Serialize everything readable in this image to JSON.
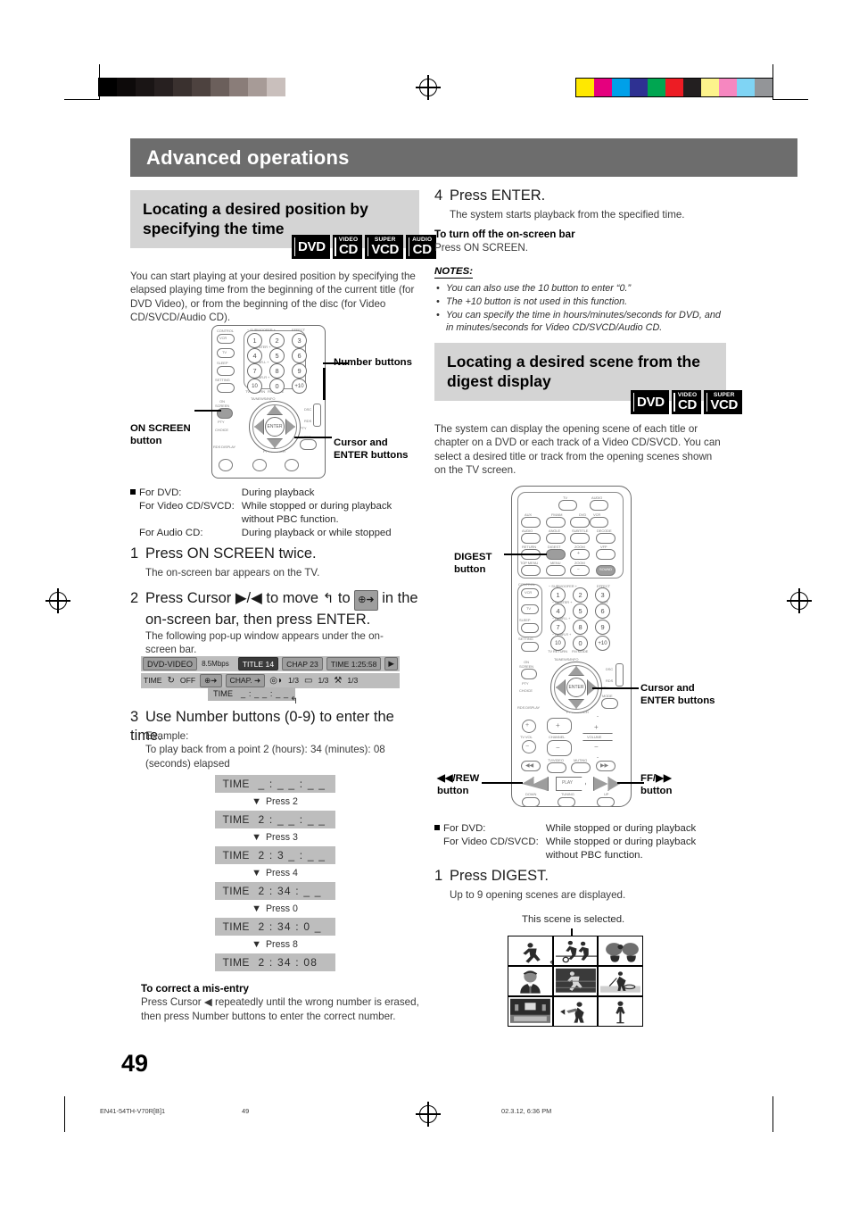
{
  "header": {
    "banner_title": "Advanced operations"
  },
  "page": {
    "number": "49"
  },
  "footer": {
    "left": "EN41-54TH-V70R[B]1",
    "center": "49",
    "right": "02.3.12, 6:36 PM"
  },
  "left_column": {
    "section_title": "Locating a desired position by specifying the time",
    "badges": [
      {
        "small": "",
        "big": "DVD"
      },
      {
        "small": "VIDEO",
        "big": "CD"
      },
      {
        "small": "SUPER",
        "big": "VCD"
      },
      {
        "small": "AUDIO",
        "big": "CD"
      }
    ],
    "intro": "You can start playing at your desired position by specifying the elapsed playing time from the beginning of the current title (for DVD Video), or from the beginning of the disc (for Video CD/SVCD/Audio CD).",
    "callouts": {
      "number_buttons": "Number buttons",
      "on_screen_button_l1": "ON SCREEN",
      "on_screen_button_l2": "button",
      "cursor_enter_l1": "Cursor and",
      "cursor_enter_l2": "ENTER buttons"
    },
    "conditions": [
      {
        "key": "For DVD:",
        "value": "During playback"
      },
      {
        "key": "For Video CD/SVCD:",
        "value": "While stopped or during playback"
      },
      {
        "key": "",
        "value": "without PBC function."
      },
      {
        "key": "For Audio CD:",
        "value": "During playback or while stopped"
      }
    ],
    "steps": [
      {
        "num": "1",
        "title": "Press ON SCREEN twice.",
        "body": "The on-screen bar appears on the TV."
      },
      {
        "num": "2",
        "title_a": "Press Cursor ▶/◀ to move",
        "title_b": "to",
        "title_c": "in the",
        "title_d": "on-screen bar, then press ENTER.",
        "body": "The following pop-up window appears under the on-screen bar."
      },
      {
        "num": "3",
        "title": "Use Number buttons (0-9) to enter the time.",
        "body_l1": "Example:",
        "body_l2": "To play back from a point 2 (hours): 34 (minutes): 08",
        "body_l3": "(seconds) elapsed"
      }
    ],
    "onscreen_bar": {
      "disc_type": "DVD-VIDEO",
      "bitrate": "8.5Mbps",
      "title": "TITLE 14",
      "chapter": "CHAP 23",
      "time": "TIME 1:25:58",
      "play_icon": "▶",
      "row2": {
        "time_label": "TIME",
        "repeat_icon": "↻",
        "repeat_value": "OFF",
        "time_search": "⊕➜",
        "chapter_search": "CHAP. ➜",
        "audio_icon": "◎◗",
        "audio_value": "1/3",
        "subtitle_icon": "▭",
        "subtitle_value": "1/3",
        "angle_icon": "⚒",
        "angle_value": "1/3"
      },
      "popup_label": "TIME",
      "popup_value": "_ : _ _ : _ _"
    },
    "time_sequence": [
      {
        "label": "TIME",
        "value": "_ : _ _ : _ _",
        "press": "Press 2"
      },
      {
        "label": "TIME",
        "value": "2 : _ _ : _ _",
        "press": "Press 3"
      },
      {
        "label": "TIME",
        "value": "2 : 3 _ : _ _",
        "press": "Press 4"
      },
      {
        "label": "TIME",
        "value": "2 : 34 : _ _",
        "press": "Press 0"
      },
      {
        "label": "TIME",
        "value": "2 : 34 : 0 _",
        "press": "Press 8"
      },
      {
        "label": "TIME",
        "value": "2 : 34 : 08",
        "press": ""
      }
    ],
    "mis_entry": {
      "heading": "To correct a mis-entry",
      "body": "Press Cursor ◀ repeatedly until the wrong number is erased, then press Number buttons to enter the correct number."
    }
  },
  "right_column": {
    "step4": {
      "num": "4",
      "title": "Press ENTER.",
      "body": "The system starts playback from the specified time."
    },
    "turn_off": {
      "heading": "To turn off the on-screen bar",
      "body": "Press ON SCREEN."
    },
    "notes_heading": "NOTES:",
    "notes": [
      "You can also use the 10 button to enter “0.”",
      "The +10 button is not used in this function.",
      "You can specify the time in hours/minutes/seconds for DVD, and in minutes/seconds for Video CD/SVCD/Audio CD."
    ],
    "section_title": "Locating a desired scene from the digest display",
    "badges": [
      {
        "small": "",
        "big": "DVD"
      },
      {
        "small": "VIDEO",
        "big": "CD"
      },
      {
        "small": "SUPER",
        "big": "VCD"
      }
    ],
    "intro": "The system can display the opening scene of each title or chapter on a DVD or each track of a Video CD/SVCD. You can select a desired title or track from the opening scenes shown on the TV screen.",
    "callouts": {
      "digest_button_l1": "DIGEST",
      "digest_button_l2": "button",
      "cursor_enter_l1": "Cursor and",
      "cursor_enter_l2": "ENTER buttons",
      "rew_button_l1": "◀◀/REW",
      "rew_button_l2": "button",
      "ff_button_l1": "FF/▶▶",
      "ff_button_l2": "button"
    },
    "conditions": [
      {
        "key": "For DVD:",
        "value": "While stopped or during playback"
      },
      {
        "key": "For Video CD/SVCD:",
        "value": "While stopped or during playback"
      },
      {
        "key": "",
        "value": "without PBC function."
      }
    ],
    "step1": {
      "num": "1",
      "title": "Press DIGEST.",
      "body": "Up to 9 opening scenes are displayed."
    },
    "digest_caption": "This scene is selected.",
    "digest_scenes": [
      "baseball-pitcher",
      "soccer-players",
      "sumo-wrestlers",
      "news-anchor",
      "climbing-wall",
      "golfer",
      "tv-studio",
      "trumpet-player",
      "standing-person"
    ]
  },
  "remote_left": {
    "number_buttons": [
      "1",
      "2",
      "3",
      "4",
      "5",
      "6",
      "7",
      "8",
      "9",
      "10",
      "0",
      "+10"
    ],
    "labels": {
      "control": "CONTROL",
      "vcr": "VCR",
      "tv": "TV",
      "sleep": "SLEEP",
      "setting": "SETTING",
      "subwoofer": "− SUBWOOFER +",
      "center": "−  CENTER  +",
      "rear_l": "−  REAR-L  +",
      "rear_r": "−  REAR-R  +",
      "effect": "EFFECT",
      "test": "TEST",
      "tv_return": "TV RETURN",
      "fm_mode": "FM MODE",
      "hundred": "100+",
      "on_screen": "ON SCREEN",
      "pty": "PTY",
      "choice": "CHOICE",
      "rds_display": "RDS DISPLAY",
      "ta_news_info": "TA/NEWS/INFO",
      "pty_search": "PTY SEARCH",
      "enter": "ENTER",
      "dsc": "DSC",
      "rds": "RDS",
      "mode": "MODE"
    }
  },
  "remote_right": {
    "number_buttons": [
      "1",
      "2",
      "3",
      "4",
      "5",
      "6",
      "7",
      "8",
      "9",
      "10",
      "0",
      "+10"
    ],
    "labels": {
      "tv": "TV",
      "audio": "AUDIO",
      "vcr": "VCR",
      "aux": "AUX",
      "fm_am": "FM/AM",
      "dvd": "DVD",
      "audio2": "AUDIO",
      "angle": "ANGLE",
      "subtitle": "SUBTITLE",
      "decode": "DECODE",
      "return": "RETURN",
      "digest": "DIGEST",
      "zoom_plus": "ZOOM",
      "vfp": "VFP",
      "top_menu": "TOP MENU",
      "menu": "MENU",
      "zoom_minus": "ZOOM",
      "sound": "SOUND",
      "control": "CONTROL",
      "sleep": "SLEEP",
      "setting": "SETTING",
      "subwoofer": "− SUBWOOFER +",
      "center": "−  CENTER  +",
      "rear_l": "−  REAR-L  +",
      "rear_r": "−  REAR-R  +",
      "effect": "EFFECT",
      "test": "TEST",
      "tv_return": "TV RETURN",
      "fm_mode": "FM MODE",
      "on_screen": "ON SCREEN",
      "ta_news_info": "TA/NEWS/INFO",
      "pty_search": "PTY SEARCH",
      "enter": "ENTER",
      "tv_vol": "TV VOL",
      "channel": "CHANNEL",
      "volume": "VOLUME",
      "tv_video": "TV/VIDEO",
      "muting": "MUTING",
      "play": "PLAY",
      "tuning": "TUNING",
      "down": "DOWN",
      "up": "UP",
      "pty": "PTY",
      "choice": "CHOICE",
      "rds_display": "RDS DISPLAY",
      "dsc": "DSC",
      "rds": "RDS",
      "mode": "MODE"
    }
  },
  "calibration": {
    "gray_steps": [
      "#000000",
      "#0d0a0a",
      "#1a1515",
      "#272020",
      "#3a312f",
      "#4d423f",
      "#6b5f5b",
      "#8a7d79",
      "#a79b97",
      "#c9bfbc",
      "#ffffff"
    ],
    "color_steps": [
      "#ffe800",
      "#e5007e",
      "#00a0e9",
      "#2e3192",
      "#00a651",
      "#ed1c24",
      "#231f20",
      "#fdf38c",
      "#f687c0",
      "#7fd4f4",
      "#939598"
    ]
  }
}
